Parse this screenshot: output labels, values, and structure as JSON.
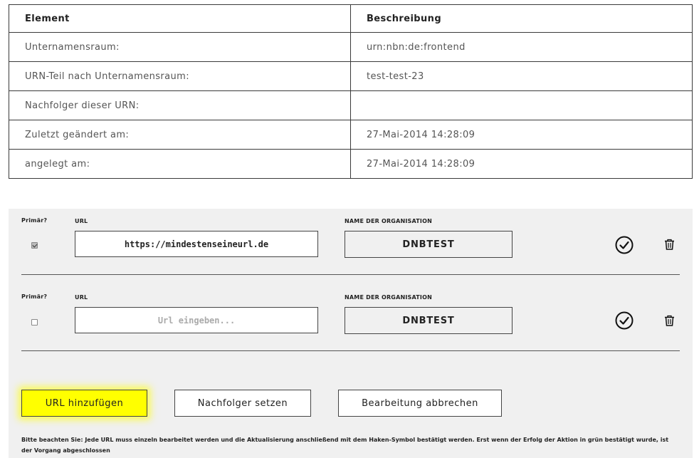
{
  "info_table": {
    "headers": [
      "Element",
      "Beschreibung"
    ],
    "rows": [
      {
        "label": "Unternamensraum:",
        "value": "urn:nbn:de:frontend"
      },
      {
        "label": "URN-Teil nach Unternamensraum:",
        "value": "test-test-23"
      },
      {
        "label": "Nachfolger dieser URN:",
        "value": ""
      },
      {
        "label": "Zuletzt geändert am:",
        "value": "27-Mai-2014 14:28:09"
      },
      {
        "label": "angelegt am:",
        "value": "27-Mai-2014 14:28:09"
      }
    ]
  },
  "url_rows": [
    {
      "primary_label": "Primär?",
      "primary_checked": true,
      "url_label": "URL",
      "url_value": "https://mindestenseineurl.de",
      "url_placeholder": "",
      "org_label": "NAME DER ORGANISATION",
      "org_value": "DNBTEST",
      "confirm_icon": "check-circle-icon",
      "delete_icon": "trash-icon"
    },
    {
      "primary_label": "Primär?",
      "primary_checked": false,
      "url_label": "URL",
      "url_value": "",
      "url_placeholder": "Url eingeben...",
      "org_label": "NAME DER ORGANISATION",
      "org_value": "DNBTEST",
      "confirm_icon": "check-circle-icon",
      "delete_icon": "trash-icon"
    }
  ],
  "actions": {
    "add_url": "URL hinzufügen",
    "set_successor": "Nachfolger setzen",
    "cancel_edit": "Bearbeitung abbrechen"
  },
  "notice": "Bitte beachten Sie: Jede URL muss einzeln bearbeitet werden und die Aktualisierung anschließend mit dem Haken-Symbol bestätigt werden. Erst wenn der Erfolg der Aktion in grün bestätigt wurde, ist der Vorgang abgeschlossen",
  "colors": {
    "panel_background": "#f0f0f0",
    "highlight": "#ffff00",
    "border": "#444444"
  }
}
